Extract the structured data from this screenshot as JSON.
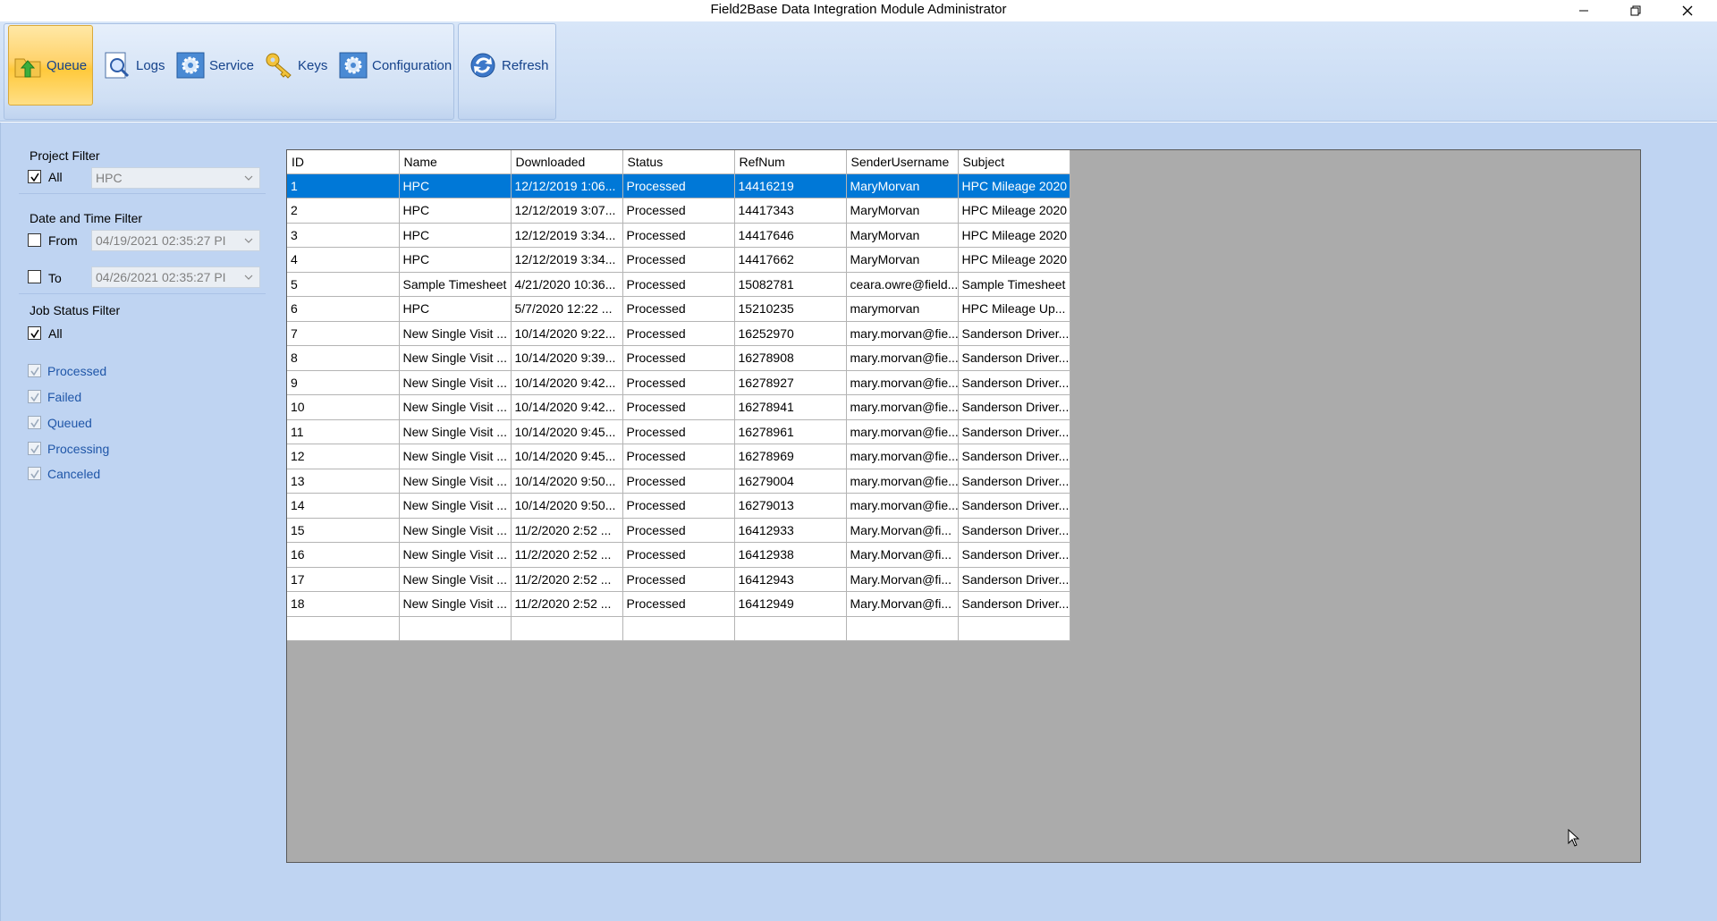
{
  "window": {
    "title": "Field2Base Data Integration Module Administrator"
  },
  "ribbon": {
    "queue": "Queue",
    "logs": "Logs",
    "service": "Service",
    "keys": "Keys",
    "configuration": "Configuration",
    "refresh": "Refresh"
  },
  "filters": {
    "project_title": "Project Filter",
    "project_all": "All",
    "project_value": "HPC",
    "datetime_title": "Date and Time Filter",
    "from_label": "From",
    "from_value": "04/19/2021 02:35:27 PI",
    "to_label": "To",
    "to_value": "04/26/2021 02:35:27 PI",
    "status_title": "Job Status Filter",
    "status_all": "All",
    "statuses": [
      "Processed",
      "Failed",
      "Queued",
      "Processing",
      "Canceled"
    ]
  },
  "grid": {
    "columns": [
      "ID",
      "Name",
      "Downloaded",
      "Status",
      "RefNum",
      "SenderUsername",
      "Subject"
    ],
    "rows": [
      [
        "1",
        "HPC",
        "12/12/2019 1:06...",
        "Processed",
        "14416219",
        "MaryMorvan",
        "HPC Mileage 2020"
      ],
      [
        "2",
        "HPC",
        "12/12/2019 3:07...",
        "Processed",
        "14417343",
        "MaryMorvan",
        "HPC Mileage 2020"
      ],
      [
        "3",
        "HPC",
        "12/12/2019 3:34...",
        "Processed",
        "14417646",
        "MaryMorvan",
        "HPC Mileage 2020"
      ],
      [
        "4",
        "HPC",
        "12/12/2019 3:34...",
        "Processed",
        "14417662",
        "MaryMorvan",
        "HPC Mileage 2020"
      ],
      [
        "5",
        "Sample Timesheet",
        "4/21/2020 10:36...",
        "Processed",
        "15082781",
        "ceara.owre@field...",
        "Sample Timesheet"
      ],
      [
        "6",
        "HPC",
        "5/7/2020 12:22 ...",
        "Processed",
        "15210235",
        "marymorvan",
        "HPC Mileage Up..."
      ],
      [
        "7",
        "New Single Visit ...",
        "10/14/2020 9:22...",
        "Processed",
        "16252970",
        "mary.morvan@fie...",
        "Sanderson Driver..."
      ],
      [
        "8",
        "New Single Visit ...",
        "10/14/2020 9:39...",
        "Processed",
        "16278908",
        "mary.morvan@fie...",
        "Sanderson Driver..."
      ],
      [
        "9",
        "New Single Visit ...",
        "10/14/2020 9:42...",
        "Processed",
        "16278927",
        "mary.morvan@fie...",
        "Sanderson Driver..."
      ],
      [
        "10",
        "New Single Visit ...",
        "10/14/2020 9:42...",
        "Processed",
        "16278941",
        "mary.morvan@fie...",
        "Sanderson Driver..."
      ],
      [
        "11",
        "New Single Visit ...",
        "10/14/2020 9:45...",
        "Processed",
        "16278961",
        "mary.morvan@fie...",
        "Sanderson Driver..."
      ],
      [
        "12",
        "New Single Visit ...",
        "10/14/2020 9:45...",
        "Processed",
        "16278969",
        "mary.morvan@fie...",
        "Sanderson Driver..."
      ],
      [
        "13",
        "New Single Visit ...",
        "10/14/2020 9:50...",
        "Processed",
        "16279004",
        "mary.morvan@fie...",
        "Sanderson Driver..."
      ],
      [
        "14",
        "New Single Visit ...",
        "10/14/2020 9:50...",
        "Processed",
        "16279013",
        "mary.morvan@fie...",
        "Sanderson Driver..."
      ],
      [
        "15",
        "New Single Visit ...",
        "11/2/2020 2:52 ...",
        "Processed",
        "16412933",
        "Mary.Morvan@fi...",
        "Sanderson Driver..."
      ],
      [
        "16",
        "New Single Visit ...",
        "11/2/2020 2:52 ...",
        "Processed",
        "16412938",
        "Mary.Morvan@fi...",
        "Sanderson Driver..."
      ],
      [
        "17",
        "New Single Visit ...",
        "11/2/2020 2:52 ...",
        "Processed",
        "16412943",
        "Mary.Morvan@fi...",
        "Sanderson Driver..."
      ],
      [
        "18",
        "New Single Visit ...",
        "11/2/2020 2:52 ...",
        "Processed",
        "16412949",
        "Mary.Morvan@fi...",
        "Sanderson Driver..."
      ]
    ],
    "selected_row": 0
  },
  "colors": {
    "selection": "#0078d7",
    "ribbon_text": "#15428b",
    "workspace": "#bfd4f2",
    "grid_empty": "#ababab"
  }
}
